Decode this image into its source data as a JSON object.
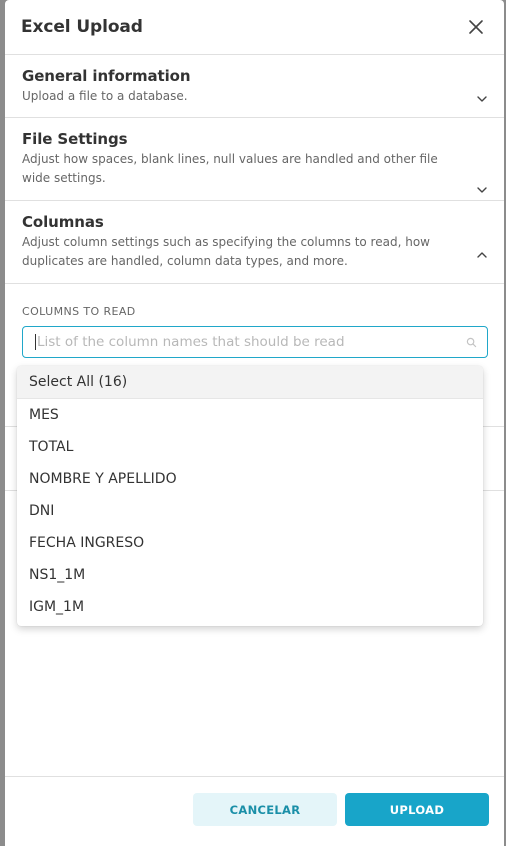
{
  "modal": {
    "title": "Excel Upload"
  },
  "panels": [
    {
      "title": "General information",
      "description": "Upload a file to a database.",
      "state": "collapsed"
    },
    {
      "title": "File Settings",
      "description": "Adjust how spaces, blank lines, null values are handled and other file wide settings.",
      "state": "collapsed"
    },
    {
      "title": "Columnas",
      "description": "Adjust column settings such as specifying the columns to read, how duplicates are handled, column data types, and more.",
      "state": "expanded"
    }
  ],
  "columns_field": {
    "label": "COLUMNS TO READ",
    "placeholder": "List of the column names that should be read",
    "value": ""
  },
  "dropdown": {
    "options": [
      "Select All (16)",
      "MES",
      "TOTAL",
      "NOMBRE Y APELLIDO",
      "DNI",
      "FECHA INGRESO",
      "NS1_1M",
      "IGM_1M"
    ]
  },
  "footer": {
    "cancel_label": "CANCELAR",
    "upload_label": "UPLOAD"
  },
  "colors": {
    "accent": "#18a5c9",
    "accent_light": "#e4f5f9",
    "focus_border": "#20a7c9"
  }
}
